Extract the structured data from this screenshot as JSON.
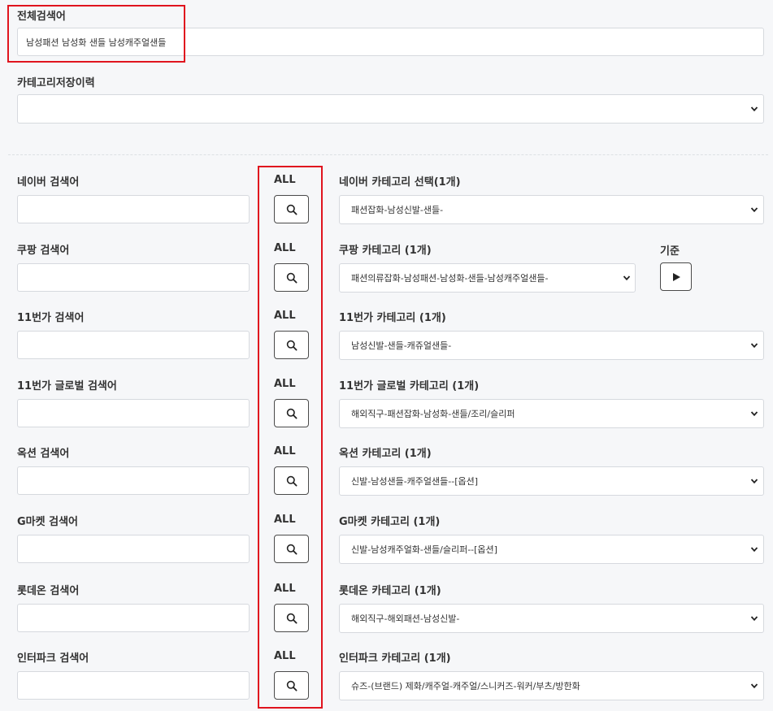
{
  "total_search": {
    "label": "전체검색어",
    "value": "남성패션 남성화 샌들 남성캐주얼샌들"
  },
  "category_history": {
    "label": "카테고리저장이력",
    "selected": ""
  },
  "all_label": "ALL",
  "basis_label": "기준",
  "rows": [
    {
      "search_label": "네이버 검색어",
      "search_value": "",
      "category_label": "네이버 카테고리 선택(1개)",
      "category_value": "패션잡화-남성신발-샌들-"
    },
    {
      "search_label": "쿠팡 검색어",
      "search_value": "",
      "category_label": "쿠팡 카테고리 (1개)",
      "category_value": "패션의류잡화-남성패션-남성화-샌들-남성캐주얼샌들-"
    },
    {
      "search_label": "11번가 검색어",
      "search_value": "",
      "category_label": "11번가 카테고리 (1개)",
      "category_value": "남성신발-샌들-캐쥬얼샌들-"
    },
    {
      "search_label": "11번가 글로벌 검색어",
      "search_value": "",
      "category_label": "11번가 글로벌 카테고리 (1개)",
      "category_value": "해외직구-패션잡화-남성화-샌들/조리/슬리퍼"
    },
    {
      "search_label": "옥션 검색어",
      "search_value": "",
      "category_label": "옥션 카테고리 (1개)",
      "category_value": "신발-남성샌들-캐주얼샌들--[옵션]"
    },
    {
      "search_label": "G마켓 검색어",
      "search_value": "",
      "category_label": "G마켓 카테고리 (1개)",
      "category_value": "신발-남성캐주얼화-샌들/슬리퍼--[옵션]"
    },
    {
      "search_label": "롯데온 검색어",
      "search_value": "",
      "category_label": "롯데온 카테고리 (1개)",
      "category_value": "해외직구-해외패션-남성신발-"
    },
    {
      "search_label": "인터파크 검색어",
      "search_value": "",
      "category_label": "인터파크 카테고리 (1개)",
      "category_value": "슈즈-(브랜드) 제화/캐주얼-캐주얼/스니커즈-워커/부츠/방한화"
    }
  ],
  "colors": {
    "highlight": "#e0141e",
    "border": "#d6d9de",
    "background": "#f6f7f9"
  }
}
